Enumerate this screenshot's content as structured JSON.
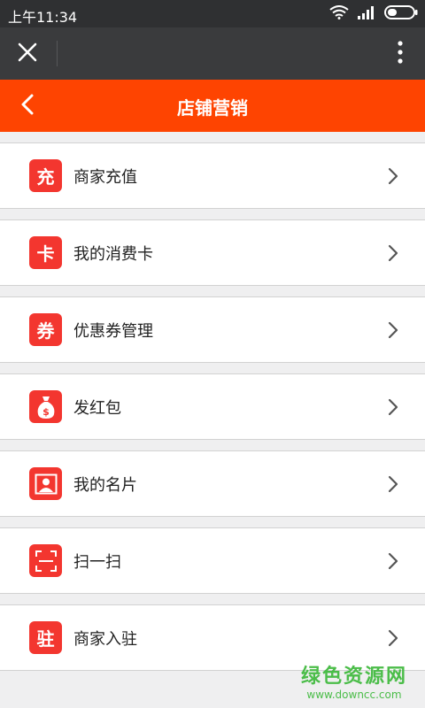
{
  "status_bar": {
    "time": "上午11:34"
  },
  "header": {
    "title": "店铺营销"
  },
  "menu": [
    {
      "label": "商家充值",
      "icon_char": "充",
      "icon": "recharge-icon"
    },
    {
      "label": "我的消费卡",
      "icon_char": "卡",
      "icon": "card-icon"
    },
    {
      "label": "优惠券管理",
      "icon_char": "券",
      "icon": "coupon-icon"
    },
    {
      "label": "发红包",
      "icon_char": "",
      "icon": "money-bag-icon"
    },
    {
      "label": "我的名片",
      "icon_char": "",
      "icon": "person-card-icon"
    },
    {
      "label": "扫一扫",
      "icon_char": "",
      "icon": "scan-icon"
    },
    {
      "label": "商家入驻",
      "icon_char": "驻",
      "icon": "merchant-join-icon"
    }
  ],
  "watermark": {
    "main": "绿色资源网",
    "sub": "www.downcc.com"
  },
  "colors": {
    "accent": "#fe4401",
    "icon_bg": "#f3362f",
    "watermark": "#4bbd49"
  }
}
